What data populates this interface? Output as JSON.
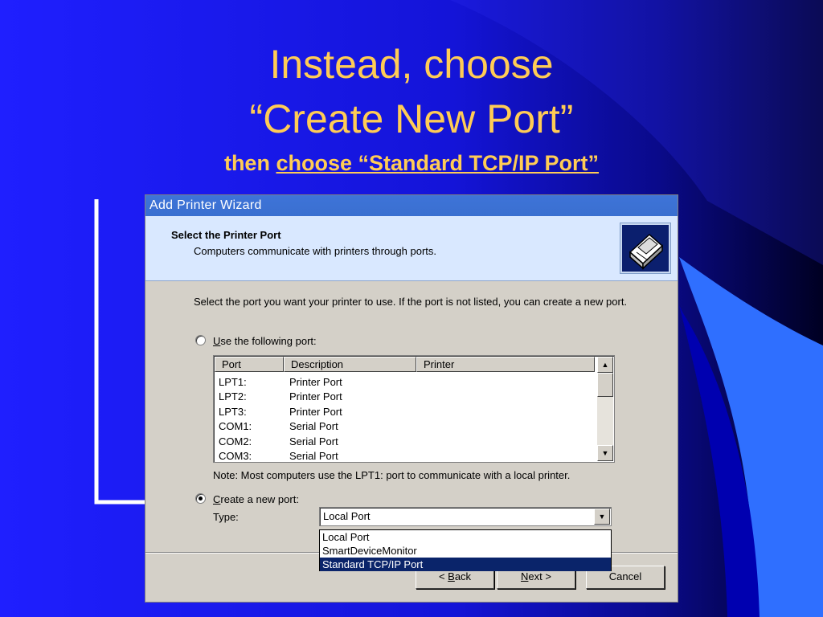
{
  "colors": {
    "title_text": "#ffcc55",
    "background": "#1a1ae8",
    "dialog_face": "#d4d0c8",
    "titlebar": "#3a6fd0",
    "selection": "#0a246a"
  },
  "slide": {
    "title_line1": "Instead, choose",
    "title_line2": "“Create New Port”",
    "subtitle_prefix": "then ",
    "subtitle_link": "choose “Standard TCP/IP Port”"
  },
  "dialog": {
    "title": "Add Printer Wizard",
    "header_title": "Select the Printer Port",
    "header_subtitle": "Computers communicate with printers through ports.",
    "header_icon": "printer-icon",
    "intro": "Select the port you want your printer to use.  If the port is not listed, you can create a new port.",
    "use_port": {
      "access_key": "U",
      "rest": "se the following port:"
    },
    "columns": [
      "Port",
      "Description",
      "Printer"
    ],
    "rows": [
      {
        "port": "LPT1:",
        "desc": "Printer Port"
      },
      {
        "port": "LPT2:",
        "desc": "Printer Port"
      },
      {
        "port": "LPT3:",
        "desc": "Printer Port"
      },
      {
        "port": "COM1:",
        "desc": "Serial Port"
      },
      {
        "port": "COM2:",
        "desc": "Serial Port"
      },
      {
        "port": "COM3:",
        "desc": "Serial Port"
      }
    ],
    "note": "Note: Most computers use the LPT1: port to communicate with a local printer.",
    "create_port": {
      "access_key": "C",
      "rest": "reate a new port:"
    },
    "type_label": "Type:",
    "type_value": "Local Port",
    "dropdown_options": [
      "Local Port",
      "SmartDeviceMonitor",
      "Standard TCP/IP Port"
    ],
    "selected_option": "Standard TCP/IP Port",
    "back": {
      "prefix": "< ",
      "access_key": "B",
      "rest": "ack"
    },
    "next": {
      "access_key": "N",
      "rest": "ext >"
    },
    "cancel": "Cancel"
  }
}
